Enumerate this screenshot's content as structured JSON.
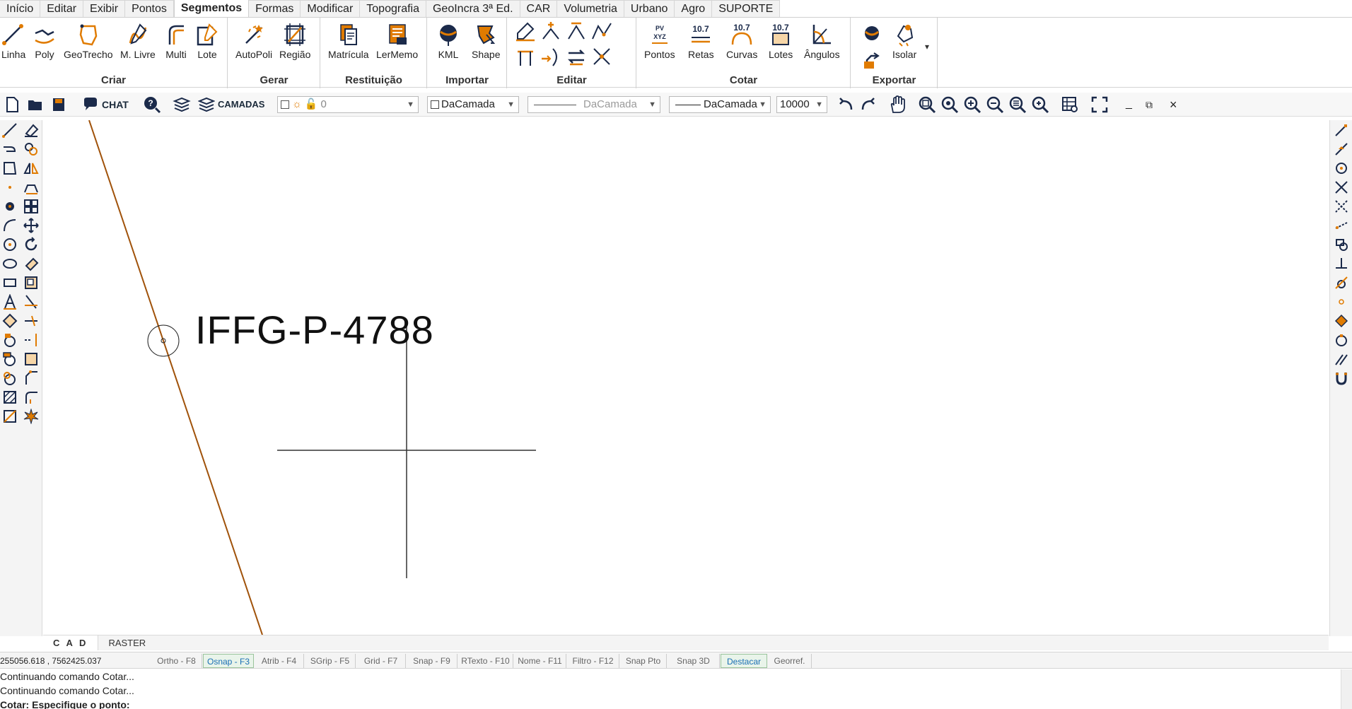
{
  "menu": {
    "tabs": [
      "Início",
      "Editar",
      "Exibir",
      "Pontos",
      "Segmentos",
      "Formas",
      "Modificar",
      "Topografia",
      "GeoIncra 3ª Ed.",
      "CAR",
      "Volumetria",
      "Urbano",
      "Agro",
      "SUPORTE"
    ],
    "active": "Segmentos"
  },
  "ribbon": {
    "criar": {
      "title": "Criar",
      "buttons": [
        "Linha",
        "Poly",
        "GeoTrecho",
        "M. Livre",
        "Multi",
        "Lote"
      ]
    },
    "gerar": {
      "title": "Gerar",
      "buttons": [
        "AutoPoli",
        "Região"
      ]
    },
    "restituicao": {
      "title": "Restituição",
      "buttons": [
        "Matrícula",
        "LerMemo"
      ]
    },
    "importar": {
      "title": "Importar",
      "buttons": [
        "KML",
        "Shape"
      ]
    },
    "editar": {
      "title": "Editar"
    },
    "cotar": {
      "title": "Cotar",
      "buttons": [
        "Pontos",
        "Retas",
        "Curvas",
        "Lotes",
        "Ângulos"
      ],
      "icon_value": "10.7",
      "pv_label": "PV",
      "xyz_label": "XYZ"
    },
    "exportar": {
      "title": "Exportar",
      "buttons": [
        "Isolar"
      ],
      "more": "▾"
    }
  },
  "toolbar": {
    "chat_label": "CHAT",
    "layers_label": "CAMADAS",
    "layer_value": "0",
    "color_value": "DaCamada",
    "linetype_value": "DaCamada",
    "lineweight_value": "DaCamada",
    "scale_value": "10000",
    "window_min": "_",
    "window_restore": "⧉",
    "window_close": "×"
  },
  "canvas": {
    "label": "IFFG-P-4788",
    "line_color": "#a0520a"
  },
  "sheet_tabs": [
    "C A D",
    "RASTER"
  ],
  "status": {
    "coords": "255056.618 , 7562425.037",
    "toggles": [
      {
        "label": "Ortho - F8",
        "on": false
      },
      {
        "label": "Osnap - F3",
        "on": true
      },
      {
        "label": "Atrib - F4",
        "on": false
      },
      {
        "label": "SGrip - F5",
        "on": false
      },
      {
        "label": "Grid - F7",
        "on": false
      },
      {
        "label": "Snap - F9",
        "on": false
      },
      {
        "label": "RTexto - F10",
        "on": false
      },
      {
        "label": "Nome - F11",
        "on": false
      },
      {
        "label": "Filtro - F12",
        "on": false
      },
      {
        "label": "Snap Pto",
        "on": false
      },
      {
        "label": "Snap 3D",
        "on": false
      },
      {
        "label": "Destacar",
        "on": true
      },
      {
        "label": "Georref.",
        "on": false
      }
    ]
  },
  "command_log": [
    "Continuando comando Cotar...",
    "Continuando comando Cotar...",
    "Cotar: Especifique o ponto:"
  ],
  "colors": {
    "accent_orange": "#e07b00",
    "icon_navy": "#1b2a4a",
    "active_toggle": "#1a6fb5"
  }
}
